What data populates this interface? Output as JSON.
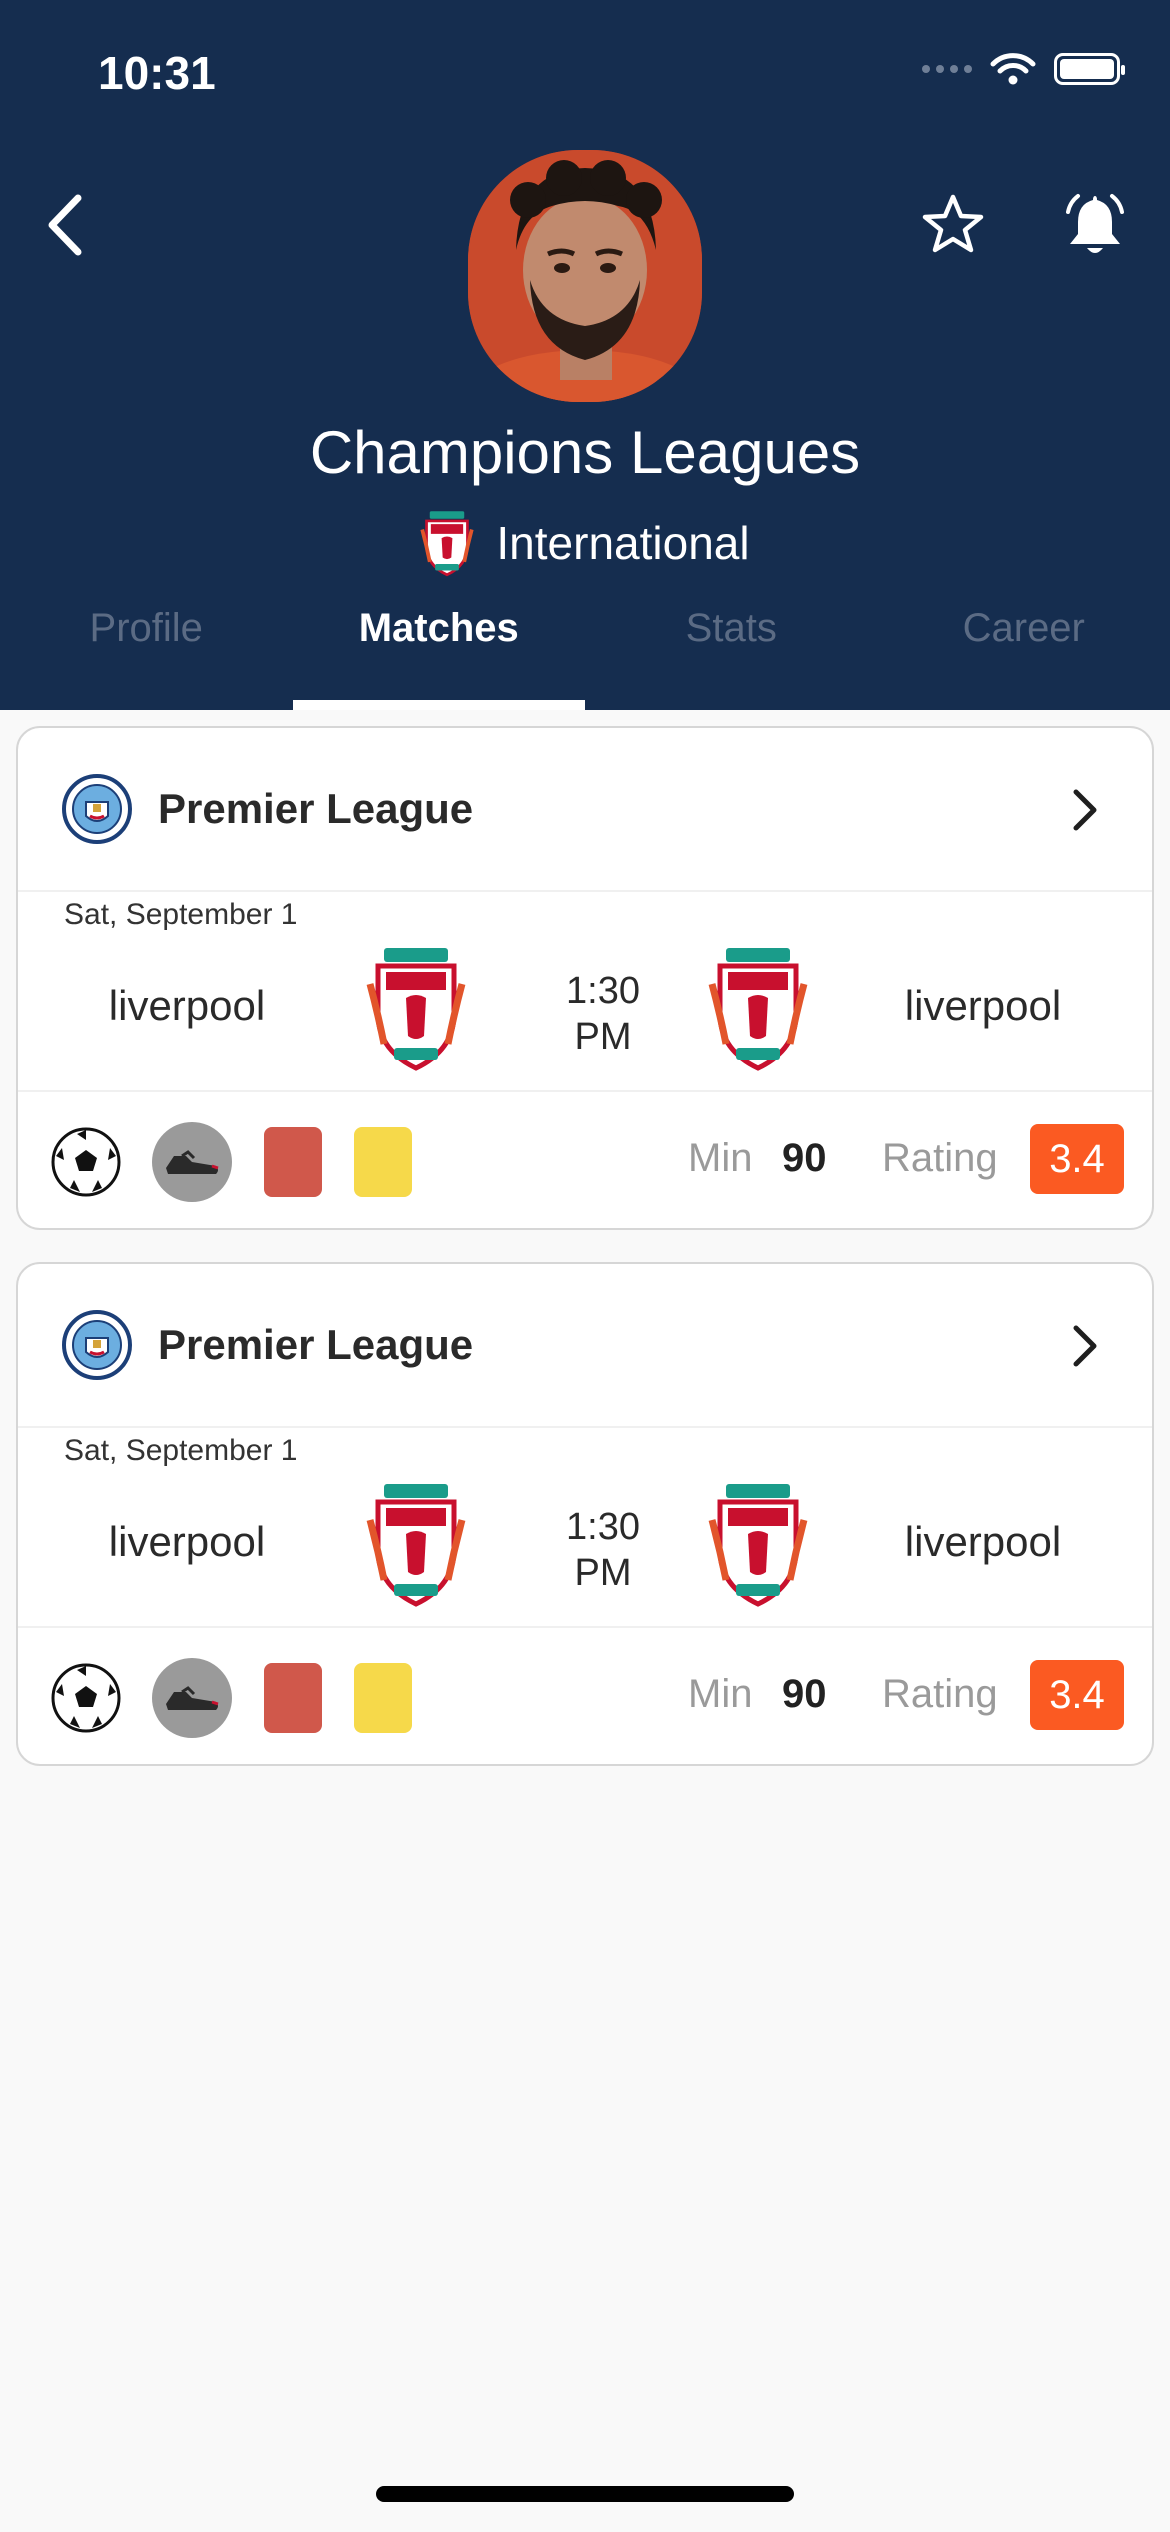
{
  "status": {
    "time": "10:31"
  },
  "header": {
    "title": "Champions Leagues",
    "subtitle": "International"
  },
  "tabs": [
    {
      "label": "Profile",
      "active": false
    },
    {
      "label": "Matches",
      "active": true
    },
    {
      "label": "Stats",
      "active": false
    },
    {
      "label": "Career",
      "active": false
    }
  ],
  "matches": [
    {
      "league": "Premier League",
      "date": "Sat, September 1",
      "home_team": "liverpool",
      "away_team": "liverpool",
      "time": "1:30",
      "period": "PM",
      "min_label": "Min",
      "min_value": "90",
      "rating_label": "Rating",
      "rating_value": "3.4"
    },
    {
      "league": "Premier League",
      "date": "Sat, September 1",
      "home_team": "liverpool",
      "away_team": "liverpool",
      "time": "1:30",
      "period": "PM",
      "min_label": "Min",
      "min_value": "90",
      "rating_label": "Rating",
      "rating_value": "3.4"
    }
  ],
  "colors": {
    "header_bg": "#152d4f",
    "rating_bg": "#fb5a22",
    "red_card": "#d0584b",
    "yellow_card": "#f6d94a"
  },
  "icons": [
    "back-icon",
    "star-icon",
    "bell-icon",
    "signal-icon",
    "wifi-icon",
    "battery-icon",
    "soccer-ball-icon",
    "boot-icon",
    "chevron-right-icon"
  ]
}
